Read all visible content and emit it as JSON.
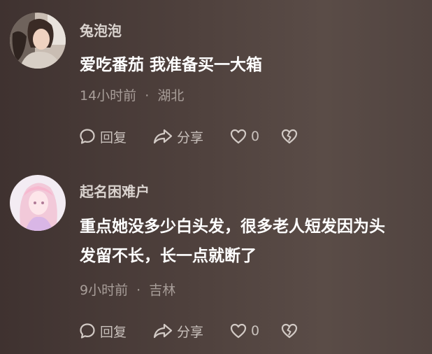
{
  "comments": [
    {
      "username": "兔泡泡",
      "content_lines": [
        "爱吃番茄 我准备买一大箱"
      ],
      "time": "14小时前",
      "location": "湖北",
      "separator": "·",
      "actions": {
        "reply_label": "回复",
        "share_label": "分享",
        "like_count": "0"
      }
    },
    {
      "username": "起名困难户",
      "content_lines": [
        "重点她没多少白头发，很多老人短发因为头",
        "发留不长，长一点就断了"
      ],
      "time": "9小时前",
      "location": "吉林",
      "separator": "·",
      "actions": {
        "reply_label": "回复",
        "share_label": "分享",
        "like_count": "0"
      }
    }
  ],
  "icons": {
    "reply": "speech-bubble-icon",
    "share": "share-arrow-icon",
    "like": "heart-icon",
    "dislike": "broken-heart-icon"
  }
}
